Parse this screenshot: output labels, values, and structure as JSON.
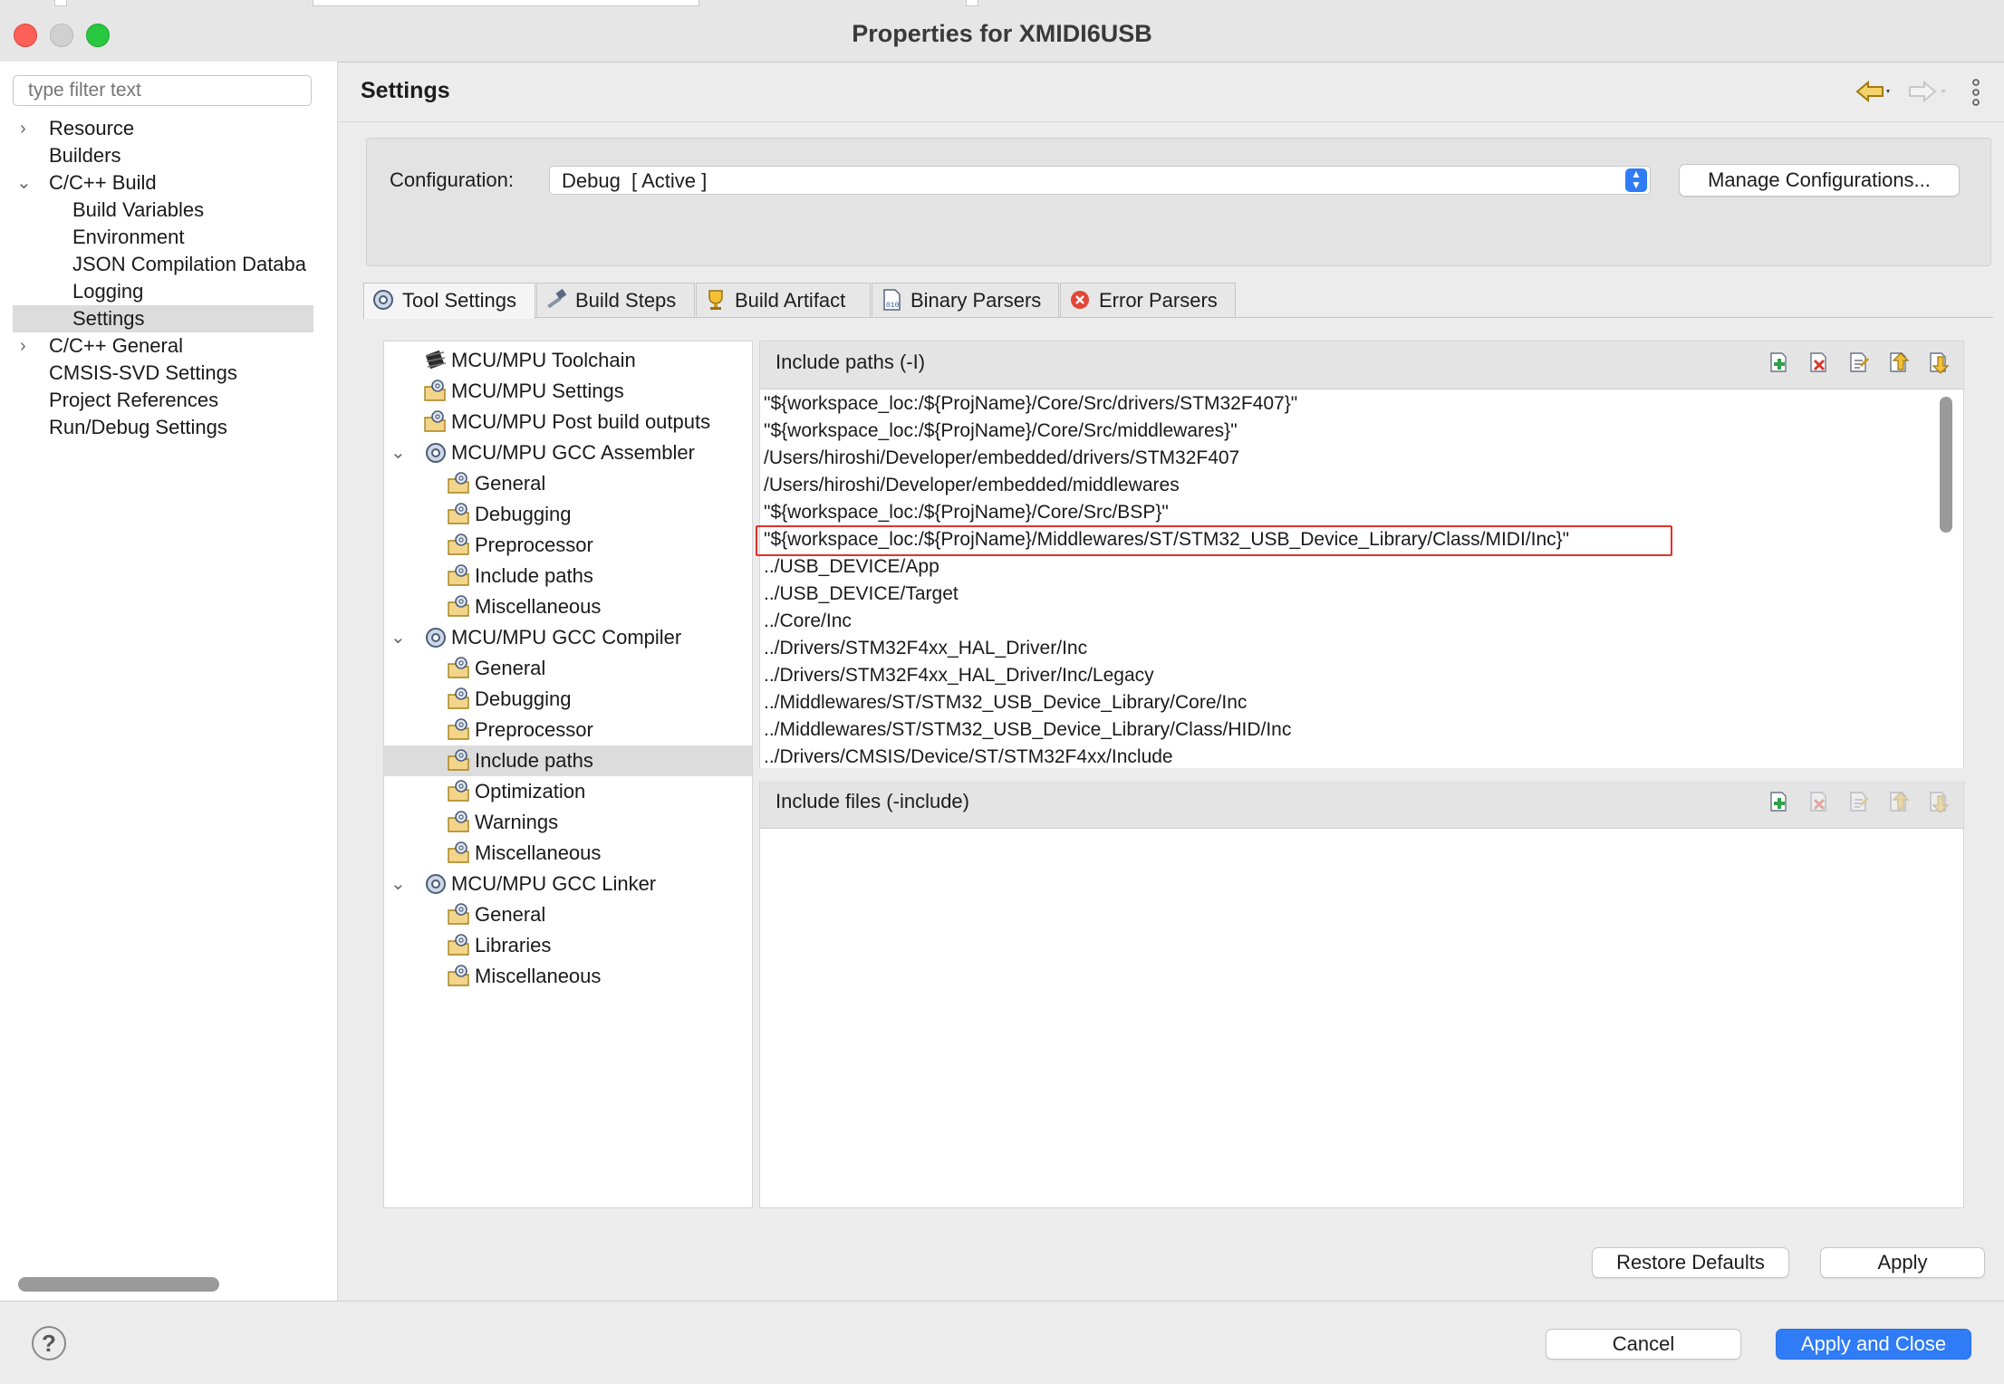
{
  "window": {
    "title": "Properties for XMIDI6USB"
  },
  "filter": {
    "placeholder": "type filter text"
  },
  "nav": {
    "items": [
      {
        "label": "Resource",
        "chevron": "›"
      },
      {
        "label": "Builders",
        "chevron": ""
      },
      {
        "label": "C/C++ Build",
        "chevron": "⌄"
      },
      {
        "label": "Build Variables",
        "chevron": ""
      },
      {
        "label": "Environment",
        "chevron": ""
      },
      {
        "label": "JSON Compilation Databa",
        "chevron": ""
      },
      {
        "label": "Logging",
        "chevron": ""
      },
      {
        "label": "Settings",
        "chevron": "",
        "selected": true
      },
      {
        "label": "C/C++ General",
        "chevron": "›"
      },
      {
        "label": "CMSIS-SVD Settings",
        "chevron": ""
      },
      {
        "label": "Project References",
        "chevron": ""
      },
      {
        "label": "Run/Debug Settings",
        "chevron": ""
      }
    ]
  },
  "page": {
    "title": "Settings"
  },
  "config": {
    "label": "Configuration:",
    "value": "Debug  [ Active ]",
    "manage_button": "Manage Configurations..."
  },
  "tabs": [
    {
      "label": "Tool Settings",
      "icon": "gear-icon",
      "active": true
    },
    {
      "label": "Build Steps",
      "icon": "hammer-icon"
    },
    {
      "label": "Build Artifact",
      "icon": "trophy-icon"
    },
    {
      "label": "Binary Parsers",
      "icon": "binary-file-icon"
    },
    {
      "label": "Error Parsers",
      "icon": "error-icon"
    }
  ],
  "tree": {
    "items": [
      {
        "label": "MCU/MPU Toolchain",
        "icon": "chip-icon",
        "chevron": ""
      },
      {
        "label": "MCU/MPU Settings",
        "icon": "tool-folder-icon",
        "chevron": ""
      },
      {
        "label": "MCU/MPU Post build outputs",
        "icon": "tool-folder-icon",
        "chevron": ""
      },
      {
        "label": "MCU/MPU GCC Assembler",
        "icon": "gear-icon",
        "chevron": "⌄"
      },
      {
        "label": "General",
        "icon": "tool-folder-icon",
        "chevron": ""
      },
      {
        "label": "Debugging",
        "icon": "tool-folder-icon",
        "chevron": ""
      },
      {
        "label": "Preprocessor",
        "icon": "tool-folder-icon",
        "chevron": ""
      },
      {
        "label": "Include paths",
        "icon": "tool-folder-icon",
        "chevron": ""
      },
      {
        "label": "Miscellaneous",
        "icon": "tool-folder-icon",
        "chevron": ""
      },
      {
        "label": "MCU/MPU GCC Compiler",
        "icon": "gear-icon",
        "chevron": "⌄"
      },
      {
        "label": "General",
        "icon": "tool-folder-icon",
        "chevron": ""
      },
      {
        "label": "Debugging",
        "icon": "tool-folder-icon",
        "chevron": ""
      },
      {
        "label": "Preprocessor",
        "icon": "tool-folder-icon",
        "chevron": ""
      },
      {
        "label": "Include paths",
        "icon": "tool-folder-icon",
        "chevron": "",
        "selected": true
      },
      {
        "label": "Optimization",
        "icon": "tool-folder-icon",
        "chevron": ""
      },
      {
        "label": "Warnings",
        "icon": "tool-folder-icon",
        "chevron": ""
      },
      {
        "label": "Miscellaneous",
        "icon": "tool-folder-icon",
        "chevron": ""
      },
      {
        "label": "MCU/MPU GCC Linker",
        "icon": "gear-icon",
        "chevron": "⌄"
      },
      {
        "label": "General",
        "icon": "tool-folder-icon",
        "chevron": ""
      },
      {
        "label": "Libraries",
        "icon": "tool-folder-icon",
        "chevron": ""
      },
      {
        "label": "Miscellaneous",
        "icon": "tool-folder-icon",
        "chevron": ""
      }
    ]
  },
  "include_paths": {
    "header": "Include paths (-I)",
    "items": [
      "\"${workspace_loc:/${ProjName}/Core/Src/drivers/STM32F407}\"",
      "\"${workspace_loc:/${ProjName}/Core/Src/middlewares}\"",
      "/Users/hiroshi/Developer/embedded/drivers/STM32F407",
      "/Users/hiroshi/Developer/embedded/middlewares",
      "\"${workspace_loc:/${ProjName}/Core/Src/BSP}\"",
      "\"${workspace_loc:/${ProjName}/Middlewares/ST/STM32_USB_Device_Library/Class/MIDI/Inc}\"",
      "../USB_DEVICE/App",
      "../USB_DEVICE/Target",
      "../Core/Inc",
      "../Drivers/STM32F4xx_HAL_Driver/Inc",
      "../Drivers/STM32F4xx_HAL_Driver/Inc/Legacy",
      "../Middlewares/ST/STM32_USB_Device_Library/Core/Inc",
      "../Middlewares/ST/STM32_USB_Device_Library/Class/HID/Inc",
      "../Drivers/CMSIS/Device/ST/STM32F4xx/Include"
    ],
    "highlighted_index": 5
  },
  "include_files": {
    "header": "Include files (-include)",
    "items": []
  },
  "toolbar_icons": [
    "add-icon",
    "delete-icon",
    "edit-icon",
    "move-up-icon",
    "move-down-icon"
  ],
  "buttons": {
    "restore_defaults": "Restore Defaults",
    "apply": "Apply",
    "cancel": "Cancel",
    "apply_and_close": "Apply and Close",
    "help": "?"
  },
  "colors": {
    "accent": "#2f7cf6",
    "highlight_border": "#e0332a",
    "selection": "#dcdcdc"
  }
}
